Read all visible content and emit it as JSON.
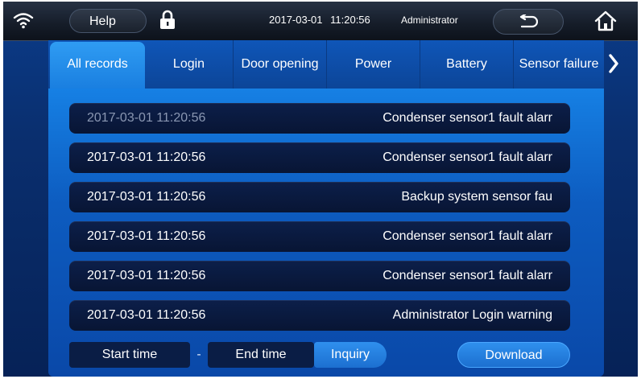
{
  "topbar": {
    "help_label": "Help",
    "date": "2017-03-01",
    "time": "11:20:56",
    "user": "Administrator",
    "icons": [
      "wifi-icon",
      "lock-icon",
      "back-icon",
      "home-icon"
    ]
  },
  "tabs": [
    {
      "label": "All records",
      "active": true
    },
    {
      "label": "Login"
    },
    {
      "label": "Door opening"
    },
    {
      "label": "Power"
    },
    {
      "label": "Battery"
    },
    {
      "label": "Sensor failure"
    }
  ],
  "records": [
    {
      "time": "2017-03-01  11:20:56",
      "message": "Condenser sensor1 fault alarr",
      "dim": true
    },
    {
      "time": "2017-03-01  11:20:56",
      "message": "Condenser sensor1 fault alarr"
    },
    {
      "time": "2017-03-01  11:20:56",
      "message": "Backup system sensor fau"
    },
    {
      "time": "2017-03-01  11:20:56",
      "message": "Condenser sensor1 fault alarr"
    },
    {
      "time": "2017-03-01  11:20:56",
      "message": "Condenser sensor1 fault alarr"
    },
    {
      "time": "2017-03-01  11:20:56",
      "message": "Administrator Login warning"
    }
  ],
  "filters": {
    "start_label": "Start time",
    "separator": "-",
    "end_label": "End time",
    "inquiry_label": "Inquiry",
    "download_label": "Download"
  },
  "colors": {
    "accent": "#1a7fe0",
    "panel": "#0d5cc0",
    "record_bg": "#0a1a40"
  }
}
